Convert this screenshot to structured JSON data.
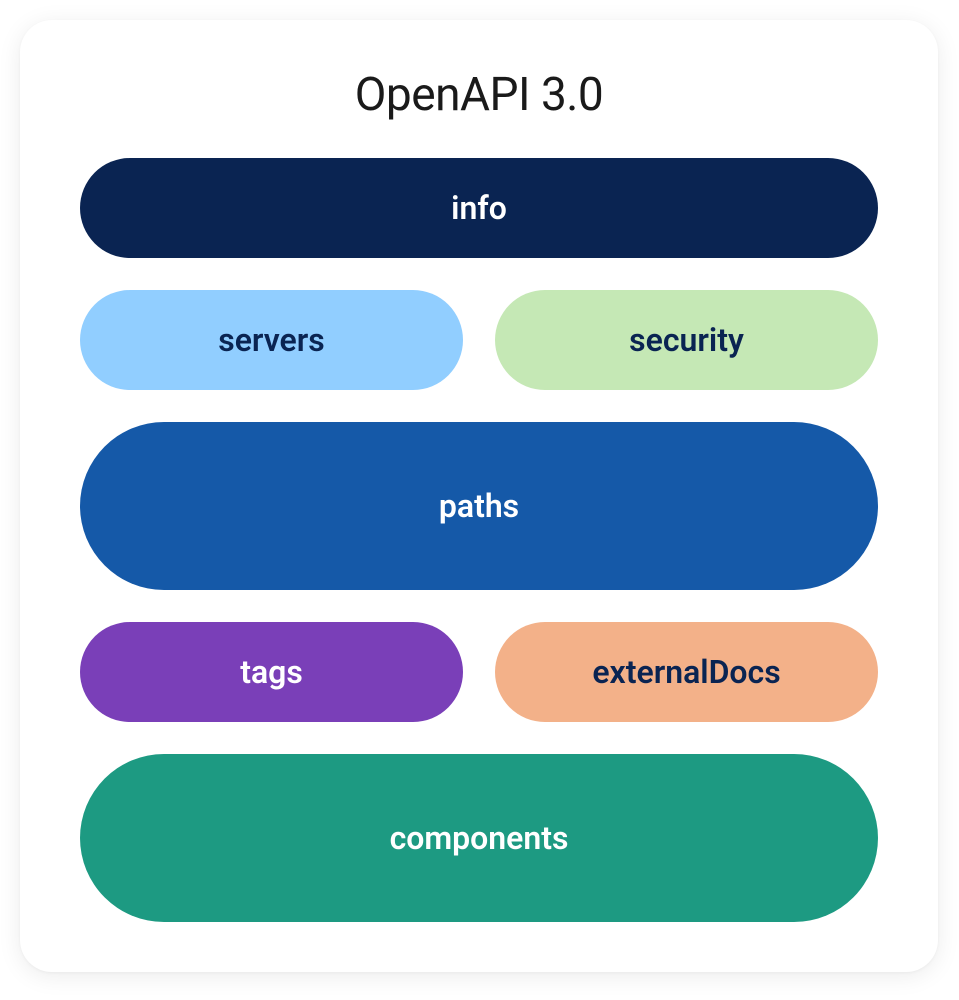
{
  "title": "OpenAPI 3.0",
  "blocks": {
    "info": {
      "label": "info",
      "bg": "#0a2452",
      "fg": "#ffffff"
    },
    "servers": {
      "label": "servers",
      "bg": "#91ceff",
      "fg": "#0a2452"
    },
    "security": {
      "label": "security",
      "bg": "#c5e8b5",
      "fg": "#0a2452"
    },
    "paths": {
      "label": "paths",
      "bg": "#1559a8",
      "fg": "#ffffff"
    },
    "tags": {
      "label": "tags",
      "bg": "#7a3fb8",
      "fg": "#ffffff"
    },
    "externalDocs": {
      "label": "externalDocs",
      "bg": "#f3b189",
      "fg": "#0a2452"
    },
    "components": {
      "label": "components",
      "bg": "#1d9a82",
      "fg": "#ffffff"
    }
  }
}
